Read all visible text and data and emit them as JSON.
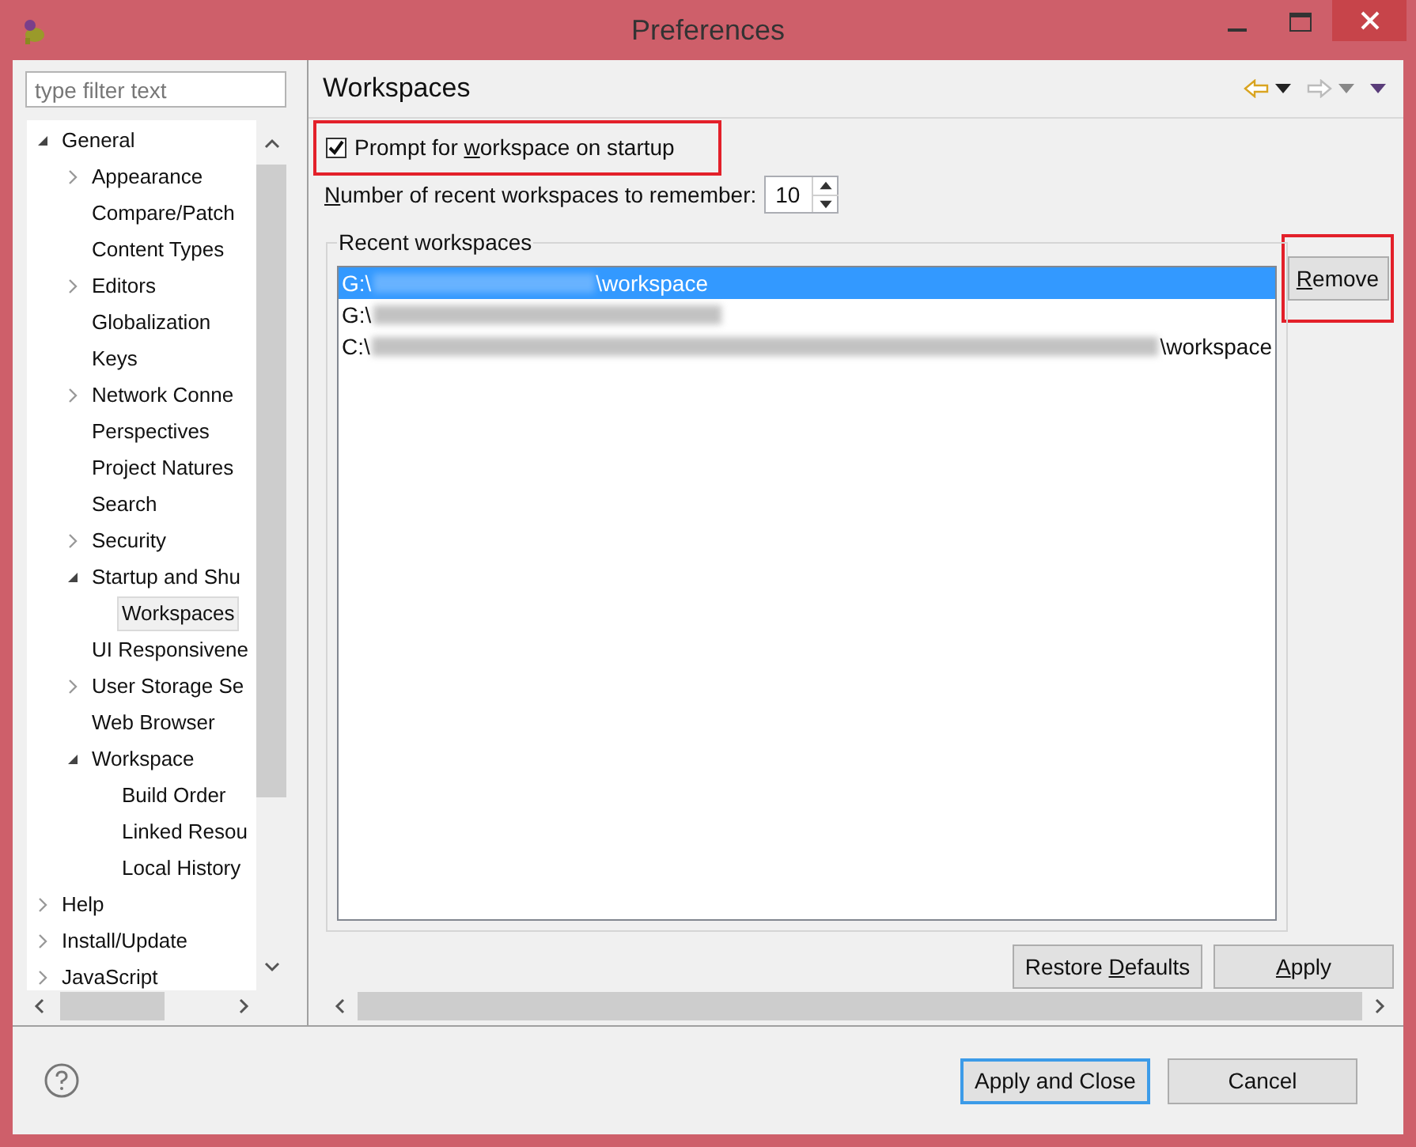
{
  "window": {
    "title": "Preferences"
  },
  "filter": {
    "placeholder": "type filter text"
  },
  "tree": [
    {
      "label": "General",
      "expanded": true,
      "selected": false,
      "children": [
        {
          "label": "Appearance",
          "expanded": false,
          "selected": false
        },
        {
          "label": "Compare/Patch",
          "selected": false
        },
        {
          "label": "Content Types",
          "selected": false
        },
        {
          "label": "Editors",
          "expanded": false,
          "selected": false
        },
        {
          "label": "Globalization",
          "selected": false
        },
        {
          "label": "Keys",
          "selected": false
        },
        {
          "label": "Network Conne",
          "expanded": false,
          "selected": false
        },
        {
          "label": "Perspectives",
          "selected": false
        },
        {
          "label": "Project Natures",
          "selected": false
        },
        {
          "label": "Search",
          "selected": false
        },
        {
          "label": "Security",
          "expanded": false,
          "selected": false
        },
        {
          "label": "Startup and Shu",
          "expanded": true,
          "selected": false,
          "children": [
            {
              "label": "Workspaces",
              "selected": true
            }
          ]
        },
        {
          "label": "UI Responsivene",
          "selected": false
        },
        {
          "label": "User Storage Se",
          "expanded": false,
          "selected": false
        },
        {
          "label": "Web Browser",
          "selected": false
        },
        {
          "label": "Workspace",
          "expanded": true,
          "selected": false,
          "children": [
            {
              "label": "Build Order",
              "selected": false
            },
            {
              "label": "Linked Resou",
              "selected": false
            },
            {
              "label": "Local History",
              "selected": false
            }
          ]
        }
      ]
    },
    {
      "label": "Help",
      "expanded": false,
      "selected": false
    },
    {
      "label": "Install/Update",
      "expanded": false,
      "selected": false
    },
    {
      "label": "JavaScript",
      "expanded": false,
      "selected": false
    }
  ],
  "page": {
    "title": "Workspaces",
    "prompt_checkbox": {
      "label_parts": {
        "before": "Prompt for ",
        "key": "w",
        "after": "orkspace on startup"
      },
      "checked": true,
      "highlighted": true
    },
    "recent_count": {
      "label_parts": {
        "key": "N",
        "after": "umber of recent workspaces to remember:"
      },
      "value": "10"
    },
    "group_title": "Recent workspaces",
    "workspaces": [
      {
        "prefix": "G:\\",
        "suffix": "\\workspace",
        "selected": true
      },
      {
        "prefix": "G:\\",
        "selected": false
      },
      {
        "prefix": "C:\\",
        "suffix": "\\workspace",
        "selected": false
      }
    ],
    "remove_button": {
      "label_parts": {
        "key": "R",
        "after": "emove"
      },
      "highlighted": true
    },
    "restore_button": {
      "label_parts": {
        "before": "Restore ",
        "key": "D",
        "after": "efaults"
      }
    },
    "apply_button": {
      "label_parts": {
        "key": "A",
        "after": "pply"
      }
    }
  },
  "footer": {
    "buttons": [
      {
        "label": "Apply and Close",
        "default": true
      },
      {
        "label": "Cancel",
        "default": false
      }
    ]
  }
}
